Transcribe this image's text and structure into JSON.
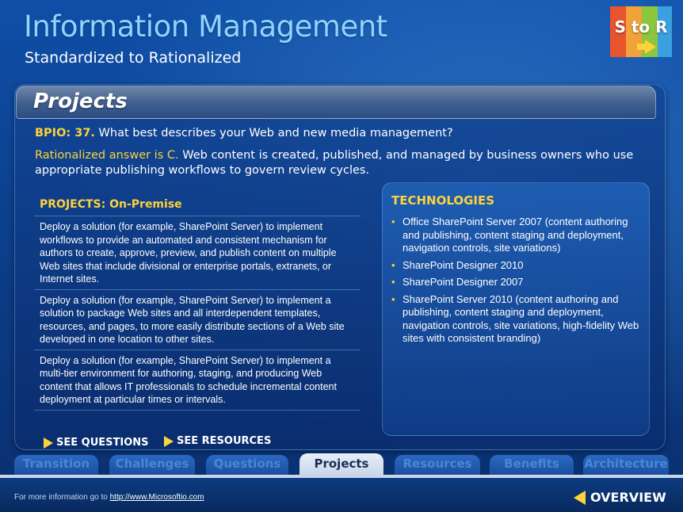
{
  "header": {
    "title": "Information Management",
    "subtitle": "Standardized to Rationalized"
  },
  "logo": {
    "text": "S to R",
    "icon": "arrow-right-icon"
  },
  "panel": {
    "title": "Projects",
    "question_label": "BPIO: 37.",
    "question_text": " What best describes your Web and new media management?",
    "answer_label": "Rationalized answer is C.",
    "answer_text": " Web content is created, published, and managed by business owners who use appropriate publishing workflows to govern review cycles."
  },
  "projects": {
    "heading": "PROJECTS: On-Premise",
    "items": [
      "Deploy a solution (for example, SharePoint Server) to implement workflows to provide an automated and consistent mechanism for authors to create, approve, preview, and publish content on multiple Web sites that include divisional or enterprise portals, extranets, or Internet sites.",
      "Deploy a solution (for example, SharePoint Server) to implement a solution to package Web sites and all interdependent templates, resources, and pages, to more easily distribute sections of a Web site developed in one location to other sites.",
      "Deploy a solution (for example, SharePoint Server) to implement a multi-tier environment for authoring, staging, and producing Web content that allows IT professionals to schedule incremental content deployment at particular times or intervals."
    ]
  },
  "technologies": {
    "heading": "TECHNOLOGIES",
    "bullet": "•",
    "items": [
      "Office SharePoint Server 2007 (content authoring and publishing, content staging and deployment, navigation controls, site variations)",
      "SharePoint Designer 2010",
      "SharePoint Designer 2007",
      "SharePoint Server 2010 (content authoring and publishing, content staging and deployment, navigation controls, site variations, high-fidelity Web sites with consistent branding)"
    ]
  },
  "links": {
    "see_questions": "SEE QUESTIONS",
    "see_resources": "SEE RESOURCES"
  },
  "tabs": [
    {
      "label": "Transition",
      "active": false
    },
    {
      "label": "Challenges",
      "active": false
    },
    {
      "label": "Questions",
      "active": false
    },
    {
      "label": "Projects",
      "active": true
    },
    {
      "label": "Resources",
      "active": false
    },
    {
      "label": "Benefits",
      "active": false
    },
    {
      "label": "Architecture",
      "active": false
    }
  ],
  "footer": {
    "text": "For more information go to ",
    "link": "http://www.Microsoftio.com",
    "overview": "OVERVIEW"
  },
  "colors": {
    "accent": "#ffd23a",
    "title": "#8fd3ff",
    "background": "#0d3f8a"
  }
}
